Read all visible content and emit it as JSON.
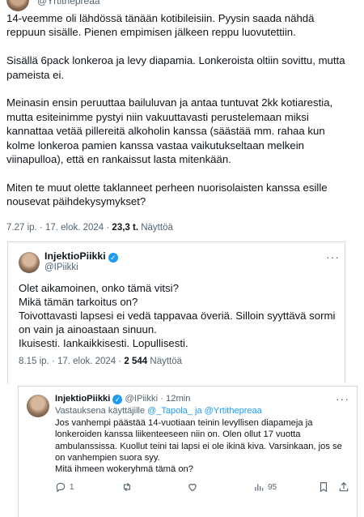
{
  "top": {
    "handle": "@Yrtithepreaa"
  },
  "main_tweet": {
    "paragraphs": [
      "14-veemme oli lähdössä tänään kotibileisiin. Pyysin saada nähdä reppuun sisälle. Pienen empimisen jälkeen reppu luovutettiin.",
      "Sisällä 6pack lonkeroa ja levy diapamia. Lonkeroista oltiin sovittu, mutta pameista ei.",
      "Meinasin ensin peruuttaa bailuluvan ja antaa tuntuvat 2kk kotiarestia, mutta esiteinimme pystyi niin vakuuttavasti perustelemaan miksi kannattaa vetää pillereitä alkoholin kanssa (säästää mm. rahaa kun kolme lonkeroa pamien kanssa vastaa vaikutukseltaan melkein viinapulloa), että en rankaissut lasta mitenkään.",
      "Miten te muut olette taklanneet perheen nuorisolaisten kanssa esille nousevat päihdekysymykset?"
    ],
    "time": "7.27 ip. · 17. elok. 2024 · ",
    "views": "23,3 t.",
    "views_label": " Näyttöä"
  },
  "reply1": {
    "name": "InjektioPiikki",
    "handle": "@IPiikki",
    "lines": [
      "Olet aikamoinen, onko tämä vitsi?",
      "Mikä tämän tarkoitus on?",
      "Toivottavasti lapsesi ei vedä tappavaa överiä. Silloin syyttävä sormi on vain ja ainoastaan sinuun.",
      "Ikuisesti. Iankaikkisesti. Lopullisesti."
    ],
    "time": "8.15 ip. · 17. elok. 2024 · ",
    "views": "2 544",
    "views_label": " Näyttöä"
  },
  "reply2": {
    "name": "InjektioPiikki",
    "handle_time": " @IPiikki · 12min",
    "reply_prefix": "Vastauksena käyttäjille ",
    "reply_users": "@_Tapola_ ja @Yrtithepreaa",
    "body": "Jos vanhempi päästää 14-vuotiaan teinin levyllisen diapameja ja lonkeroiden kanssa liikenteeseen niin on. Olen ollut 17 vuotta ambulanssissa. Kuollut teini tai lapsi ei ole ikinä kiva. Varsinkaan, jos se on vanhempien suora syy.",
    "body2": "Mitä ihmeen wokeryhmä tämä on?",
    "replies": "1",
    "views": "95"
  }
}
